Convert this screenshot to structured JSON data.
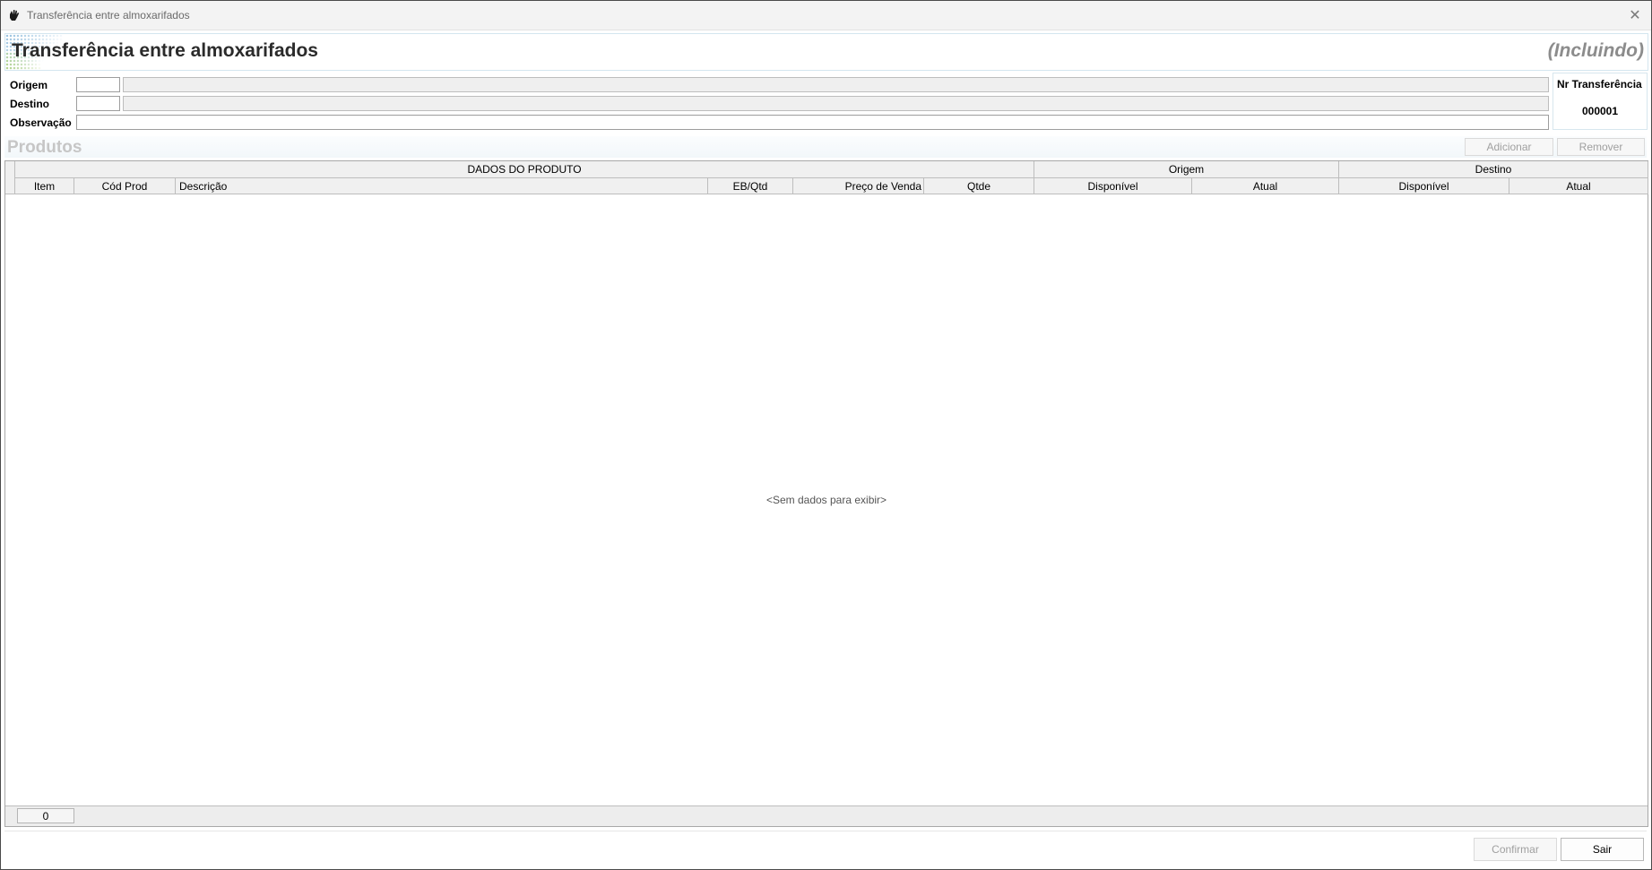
{
  "window": {
    "title": "Transferência entre almoxarifados",
    "close_glyph": "✕"
  },
  "header": {
    "title": "Transferência entre almoxarifados",
    "mode": "(Incluindo)"
  },
  "form": {
    "origem_label": "Origem",
    "destino_label": "Destino",
    "observacao_label": "Observação",
    "origem_code": "",
    "origem_name": "",
    "destino_code": "",
    "destino_name": "",
    "observacao": ""
  },
  "nr_transferencia": {
    "label": "Nr Transferência",
    "value": "000001"
  },
  "products": {
    "title": "Produtos",
    "add_label": "Adicionar",
    "remove_label": "Remover"
  },
  "grid": {
    "groups": [
      "DADOS DO PRODUTO",
      "Origem",
      "Destino"
    ],
    "columns": [
      "Item",
      "Cód Prod",
      "Descrição",
      "EB/Qtd",
      "Preço de Venda",
      "Qtde",
      "Disponível",
      "Atual",
      "Disponível",
      "Atual"
    ],
    "empty_text": "<Sem dados para exibir>",
    "count": "0"
  },
  "actions": {
    "confirm_label": "Confirmar",
    "exit_label": "Sair"
  },
  "icons": {
    "app": "hand-icon",
    "close": "close-icon"
  }
}
